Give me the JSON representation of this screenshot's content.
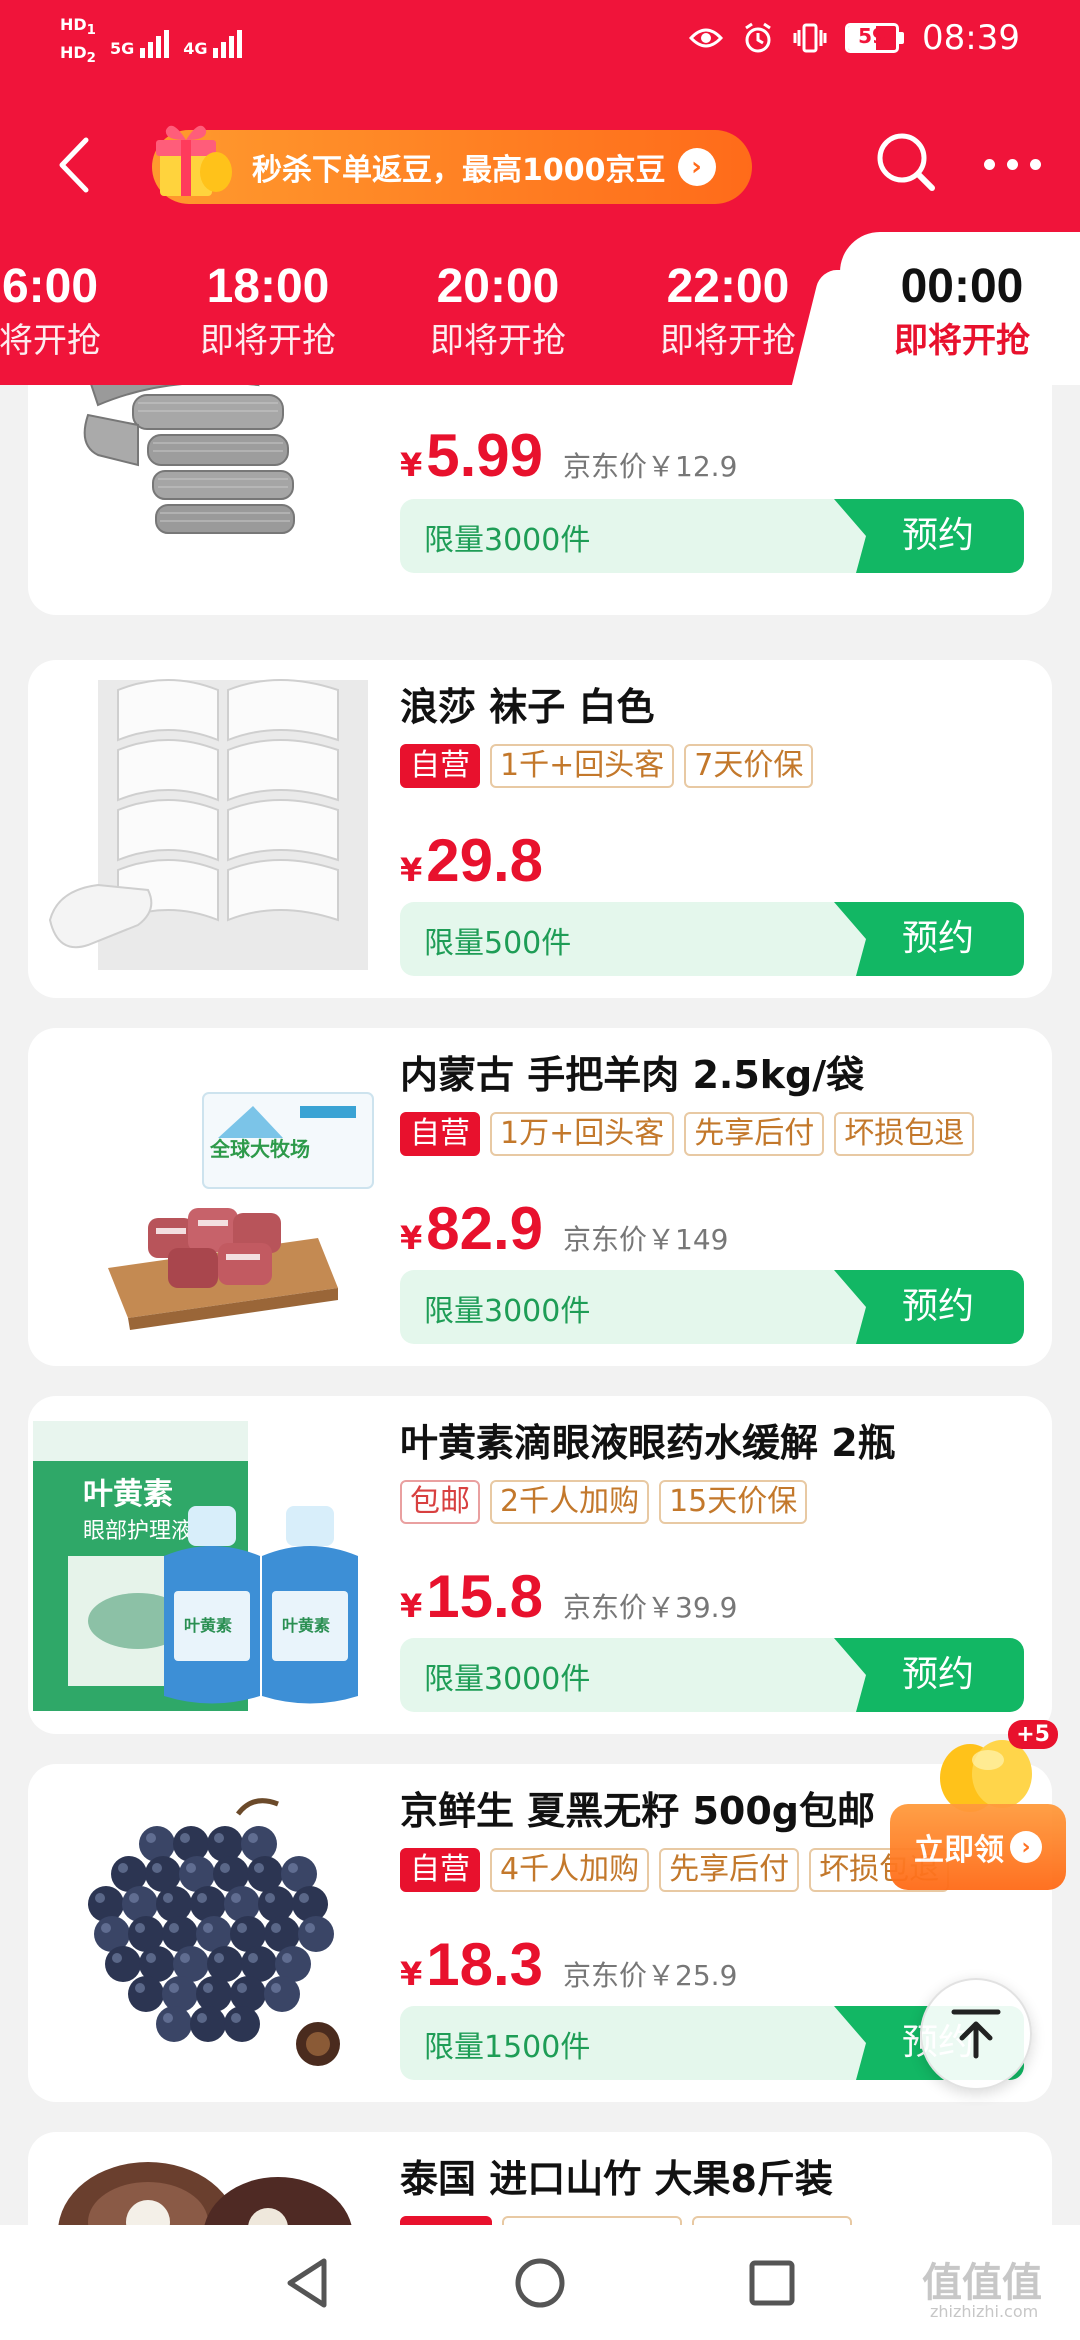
{
  "status_bar": {
    "hd1": "HD",
    "hd1_sub": "1",
    "hd2": "HD",
    "hd2_sub": "2",
    "sig1": "5G",
    "sig2": "4G",
    "battery": "59",
    "battery_level": 0.59,
    "time": "08:39"
  },
  "header": {
    "promo_text": "秒杀下单返豆，最高1000京豆",
    "icons": [
      "back-arrow-icon",
      "gift-icon",
      "search-icon",
      "more-icon"
    ]
  },
  "tabs": [
    {
      "time": "6:00",
      "status": "将开抢"
    },
    {
      "time": "18:00",
      "status": "即将开抢"
    },
    {
      "time": "20:00",
      "status": "即将开抢"
    },
    {
      "time": "22:00",
      "status": "即将开抢"
    },
    {
      "time": "00:00",
      "status": "即将开抢",
      "active": true
    }
  ],
  "products": [
    {
      "title": "",
      "tags": [],
      "price": "5.99",
      "jd_price": "京东价￥12.9",
      "limit": "限量3000件",
      "button": "预约"
    },
    {
      "title": "浪莎 袜子 白色",
      "tags": [
        "自营",
        "1千+回头客",
        "7天价保"
      ],
      "price": "29.8",
      "jd_price": "",
      "limit": "限量500件",
      "button": "预约"
    },
    {
      "title": "内蒙古 手把羊肉 2.5kg/袋",
      "tags": [
        "自营",
        "1万+回头客",
        "先享后付",
        "坏损包退"
      ],
      "price": "82.9",
      "jd_price": "京东价￥149",
      "limit": "限量3000件",
      "button": "预约",
      "package_text": "全球大牧场"
    },
    {
      "title": "叶黄素滴眼液眼药水缓解 2瓶",
      "tags": [
        "包邮",
        "2千人加购",
        "15天价保"
      ],
      "price": "15.8",
      "jd_price": "京东价￥39.9",
      "limit": "限量3000件",
      "button": "预约",
      "box_text": "叶黄素",
      "box_sub": "眼部护理液",
      "bottle_text": "叶黄素"
    },
    {
      "title": "京鲜生 夏黑无籽 500g包邮",
      "tags": [
        "自营",
        "4千人加购",
        "先享后付",
        "坏损包退"
      ],
      "price": "18.3",
      "jd_price": "京东价￥25.9",
      "limit": "限量1500件",
      "button": "预约"
    },
    {
      "title": "泰国 进口山竹 大果8斤装",
      "tags": [],
      "price": "",
      "jd_price": "",
      "limit": "",
      "button": ""
    }
  ],
  "float_coupon": {
    "plus": "+5",
    "label": "立即领"
  },
  "watermark": {
    "main": "值值值",
    "sub": "zhizhizhi.com"
  },
  "yen": "¥",
  "colors": {
    "brand_red": "#f0143a",
    "price_red": "#e8112d",
    "green": "#12b764",
    "tag_brown": "#c3782b"
  }
}
